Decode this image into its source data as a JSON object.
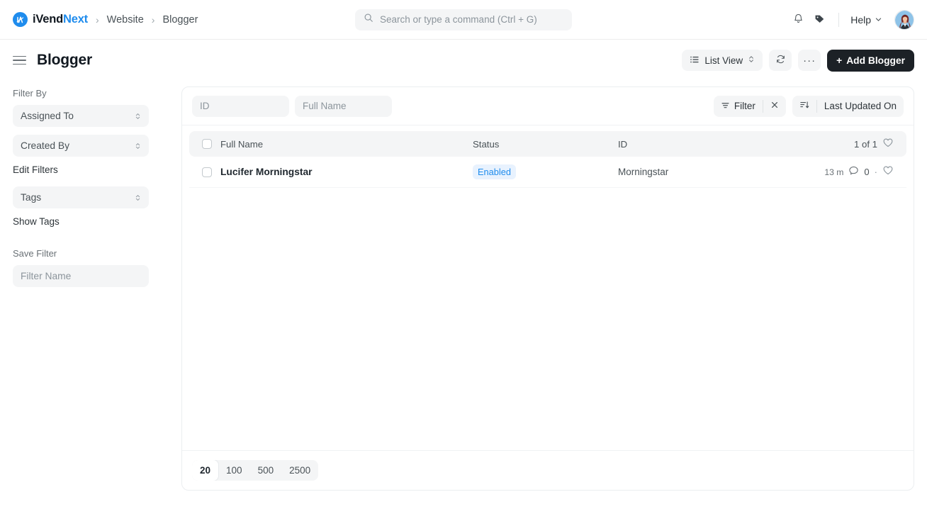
{
  "navbar": {
    "brand_first": "iVend",
    "brand_second": "Next",
    "brand_logo_icon": "ivend-monogram-icon",
    "breadcrumbs": [
      {
        "label": "Website"
      },
      {
        "label": "Blogger"
      }
    ],
    "breadcrumb_separator": "›",
    "search": {
      "placeholder": "Search or type a command (Ctrl + G)",
      "value": "",
      "icon": "search-icon"
    },
    "notifications_icon": "bell-icon",
    "tags_icon": "tag-icon",
    "help_label": "Help",
    "help_caret_icon": "chevron-down-icon",
    "avatar_icon": "user-avatar"
  },
  "page": {
    "menu_icon": "hamburger-icon",
    "title": "Blogger",
    "view_label": "List View",
    "view_icon": "list-icon",
    "view_caret_icon": "chevron-updown-icon",
    "refresh_icon": "refresh-icon",
    "more_label": "···",
    "add_label": "Add Blogger",
    "add_plus": "+"
  },
  "sidebar": {
    "filter_by_label": "Filter By",
    "assigned_to_label": "Assigned To",
    "created_by_label": "Created By",
    "edit_filters_label": "Edit Filters",
    "tags_label": "Tags",
    "show_tags_label": "Show Tags",
    "save_filter_label": "Save Filter",
    "filter_name_placeholder": "Filter Name",
    "filter_name_value": ""
  },
  "list": {
    "filters": {
      "id_placeholder": "ID",
      "id_value": "",
      "name_placeholder": "Full Name",
      "name_value": "",
      "filter_label": "Filter",
      "filter_icon": "filter-icon",
      "clear_icon": "close-icon",
      "sort_icon": "sort-descending-icon",
      "sort_label": "Last Updated On"
    },
    "columns": {
      "name": "Full Name",
      "status": "Status",
      "id": "ID",
      "count": "1 of 1",
      "like_icon": "heart-icon"
    },
    "rows": [
      {
        "name": "Lucifer Morningstar",
        "status": "Enabled",
        "id": "Morningstar",
        "modified": "13 m",
        "comments": "0",
        "comment_icon": "comment-icon",
        "separator": "·",
        "like_icon": "heart-icon"
      }
    ],
    "page_sizes": [
      "20",
      "100",
      "500",
      "2500"
    ],
    "page_size_selected": "20"
  },
  "colors": {
    "accent": "#1f8ced",
    "dark_button": "#1c2126",
    "badge_bg": "#e8f2fe",
    "soft_bg": "#f4f5f6"
  }
}
